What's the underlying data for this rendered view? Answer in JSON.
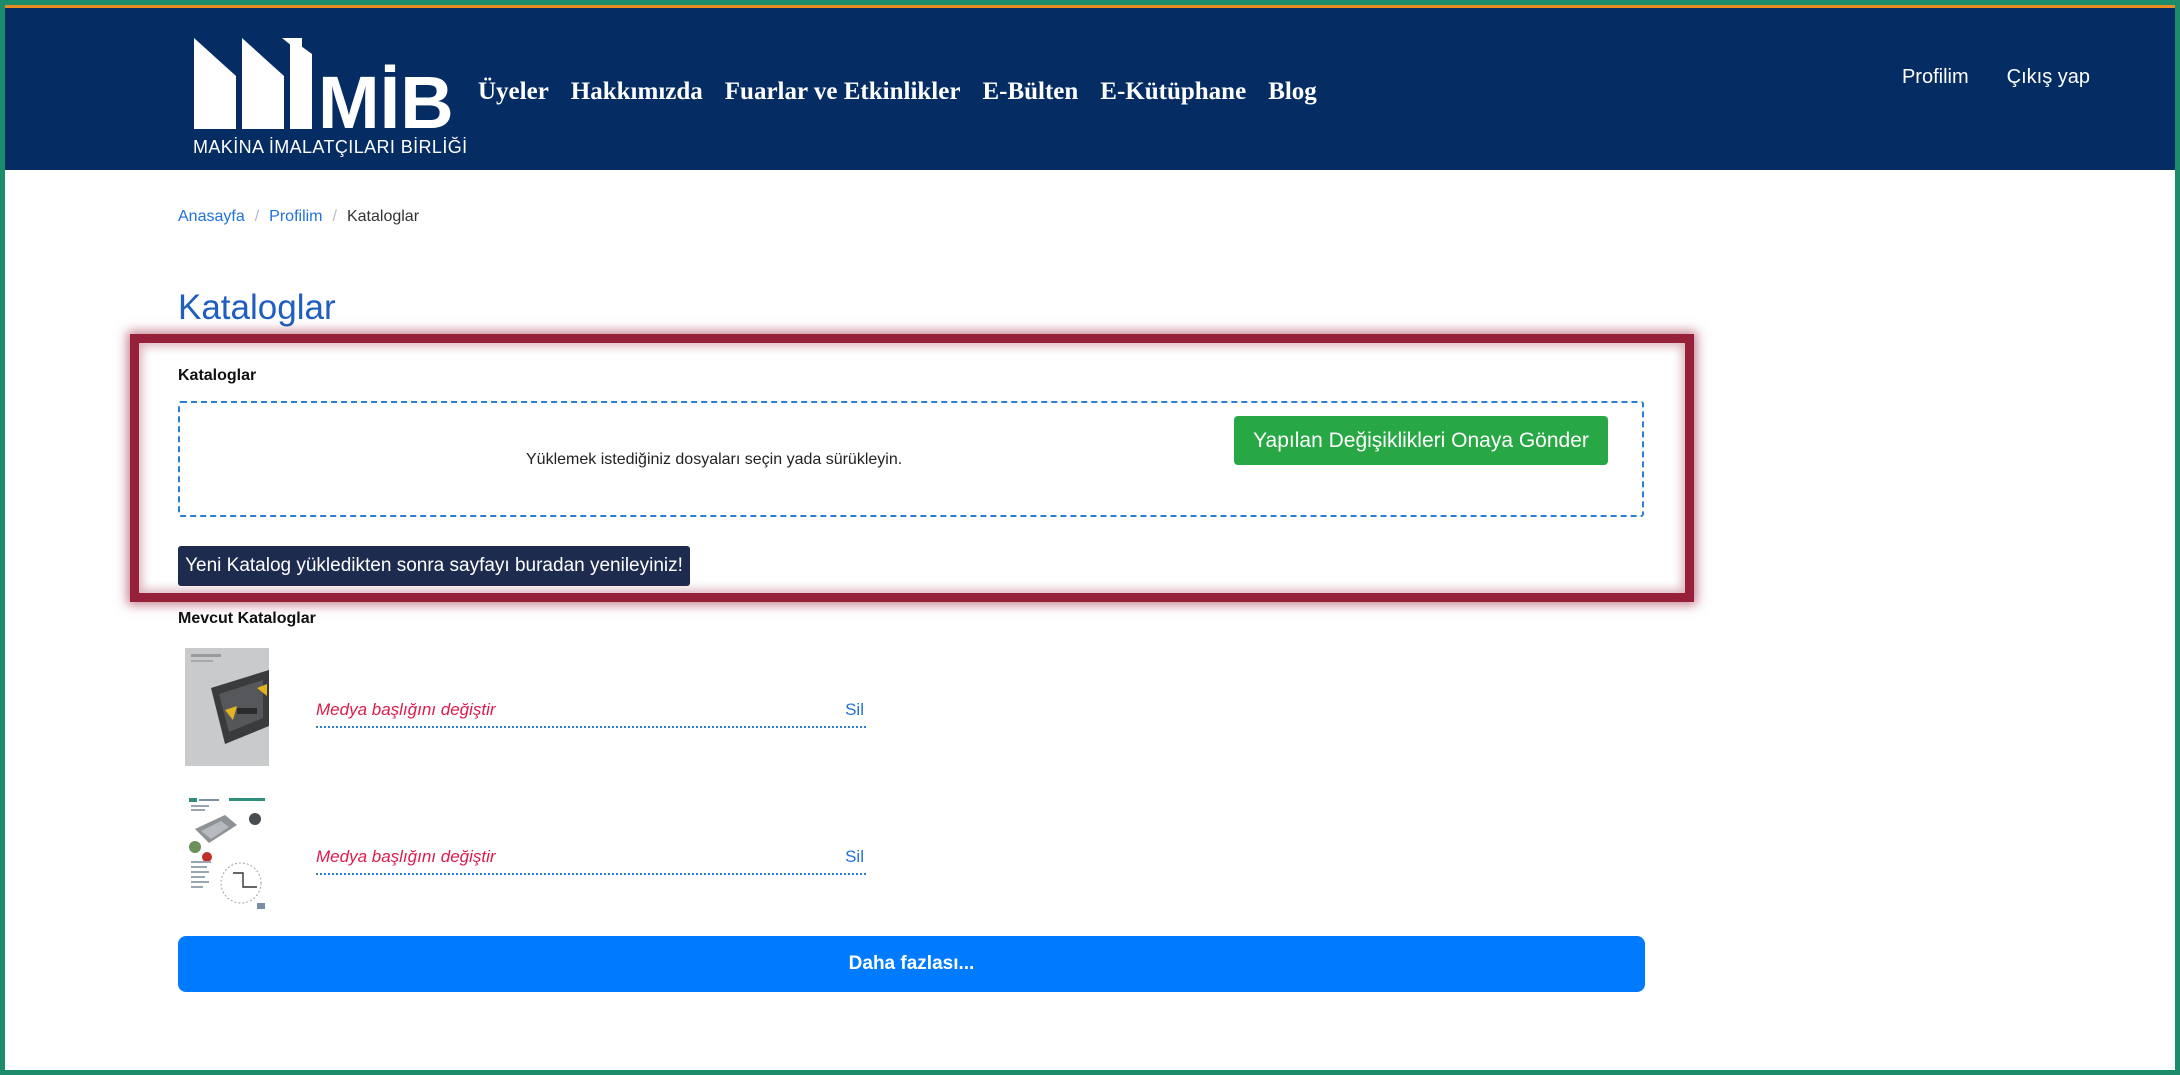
{
  "colors": {
    "navbar_bg": "#052d64",
    "top_strip": "#e88d22",
    "frame": "#1d8c6a",
    "link": "#1f73d8",
    "primary_button": "#007bff",
    "success_button": "#28a745",
    "dark_button": "#1c2b4e",
    "highlight_border": "#96203a",
    "media_title": "#dc1b4b"
  },
  "header": {
    "logo_name": "MİB",
    "logo_text": "MAKİNA İMALATÇILARI BİRLİĞİ",
    "nav": [
      {
        "label": "Üyeler"
      },
      {
        "label": "Hakkımızda"
      },
      {
        "label": "Fuarlar ve Etkinlikler"
      },
      {
        "label": "E-Bülten"
      },
      {
        "label": "E-Kütüphane"
      },
      {
        "label": "Blog"
      }
    ],
    "user_nav": {
      "profile": "Profilim",
      "logout": "Çıkış yap"
    }
  },
  "breadcrumb": [
    {
      "label": "Anasayfa"
    },
    {
      "label": "Profilim"
    },
    {
      "label": "Kataloglar"
    }
  ],
  "page_title": "Kataloglar",
  "upload": {
    "section_label": "Kataloglar",
    "dropzone_text": "Yüklemek istediğiniz dosyaları seçin yada sürükleyin.",
    "submit_button": "Yapılan Değişiklikleri Onaya Gönder",
    "refresh_button": "Yeni Katalog yükledikten sonra sayfayı buradan yenileyiniz!"
  },
  "existing": {
    "section_label": "Mevcut Kataloglar",
    "items": [
      {
        "title_placeholder": "Medya başlığını değiştir",
        "delete_label": "Sil",
        "thumbnail": "catalog-cover-icon"
      },
      {
        "title_placeholder": "Medya başlığını değiştir",
        "delete_label": "Sil",
        "thumbnail": "catalog-cover-icon"
      }
    ]
  },
  "more_button": "Daha fazlası..."
}
